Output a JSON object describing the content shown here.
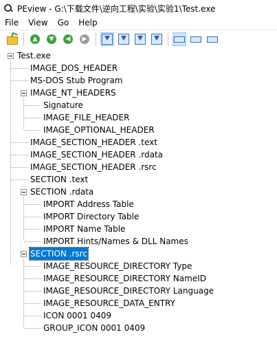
{
  "window": {
    "title": "PEview - G:\\下载文件\\逆向工程\\实验\\实验1\\Test.exe"
  },
  "menu": [
    "File",
    "View",
    "Go",
    "Help"
  ],
  "toolbar": {
    "icons": [
      "open-folder-icon",
      "nav-up-icon",
      "nav-down-icon",
      "nav-back-icon",
      "nav-forward-icon",
      "view-byte-icon",
      "view-word-icon",
      "view-dword-icon",
      "view-qword-icon",
      "view-mode-1-icon",
      "view-mode-2-icon",
      "view-mode-3-icon"
    ]
  },
  "tree": {
    "root": "Test.exe",
    "items": [
      {
        "label": "IMAGE_DOS_HEADER"
      },
      {
        "label": "MS-DOS Stub Program"
      },
      {
        "label": "IMAGE_NT_HEADERS",
        "children": [
          "Signature",
          "IMAGE_FILE_HEADER",
          "IMAGE_OPTIONAL_HEADER"
        ]
      },
      {
        "label": "IMAGE_SECTION_HEADER .text"
      },
      {
        "label": "IMAGE_SECTION_HEADER .rdata"
      },
      {
        "label": "IMAGE_SECTION_HEADER .rsrc"
      },
      {
        "label": "SECTION .text"
      },
      {
        "label": "SECTION .rdata",
        "children": [
          "IMPORT Address Table",
          "IMPORT Directory Table",
          "IMPORT Name Table",
          "IMPORT Hints/Names & DLL Names"
        ]
      },
      {
        "label": "SECTION .rsrc",
        "selected": true,
        "children": [
          "IMAGE_RESOURCE_DIRECTORY Type",
          "IMAGE_RESOURCE_DIRECTORY NameID",
          "IMAGE_RESOURCE_DIRECTORY Language",
          "IMAGE_RESOURCE_DATA_ENTRY",
          "ICON  0001  0409",
          "GROUP_ICON  0001  0409"
        ]
      }
    ]
  },
  "colors": {
    "selection": "#0078d7",
    "accent": "#2a6fc9"
  }
}
